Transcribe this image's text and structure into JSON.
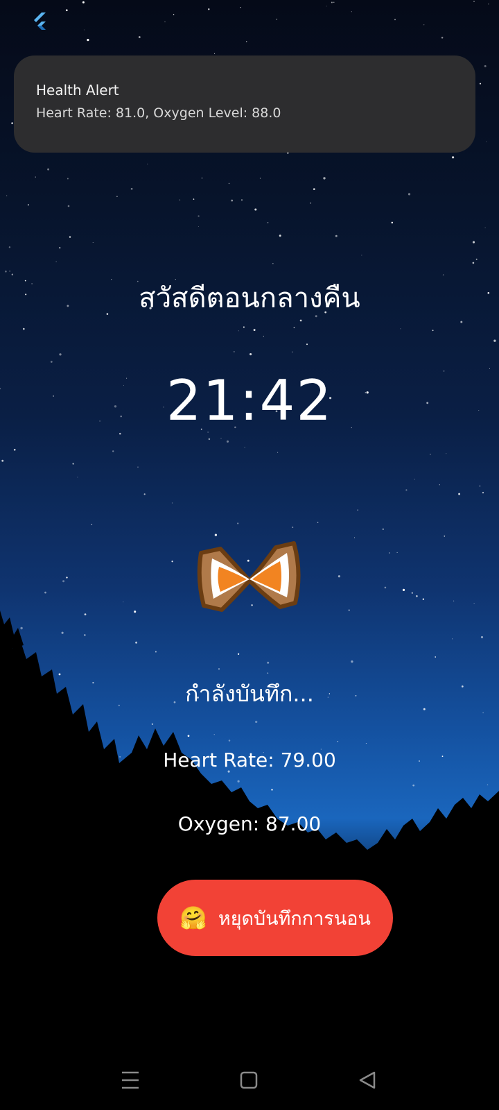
{
  "status_bar": {
    "app_icon": "flutter-icon"
  },
  "notification": {
    "title": "Health Alert",
    "message": "Heart Rate: 81.0, Oxygen Level: 88.0"
  },
  "main": {
    "greeting": "สวัสดีตอนกลางคืน",
    "time": "21:42",
    "status": "กำลังบันทึก...",
    "heart_rate": "Heart Rate: 79.00",
    "oxygen": "Oxygen: 87.00"
  },
  "stop_button": {
    "emoji": "🤗",
    "label": "หยุดบันทึกการนอน",
    "color": "#f24236"
  },
  "nav_bar": {
    "icons": [
      "menu-icon",
      "home-icon",
      "back-icon"
    ]
  }
}
